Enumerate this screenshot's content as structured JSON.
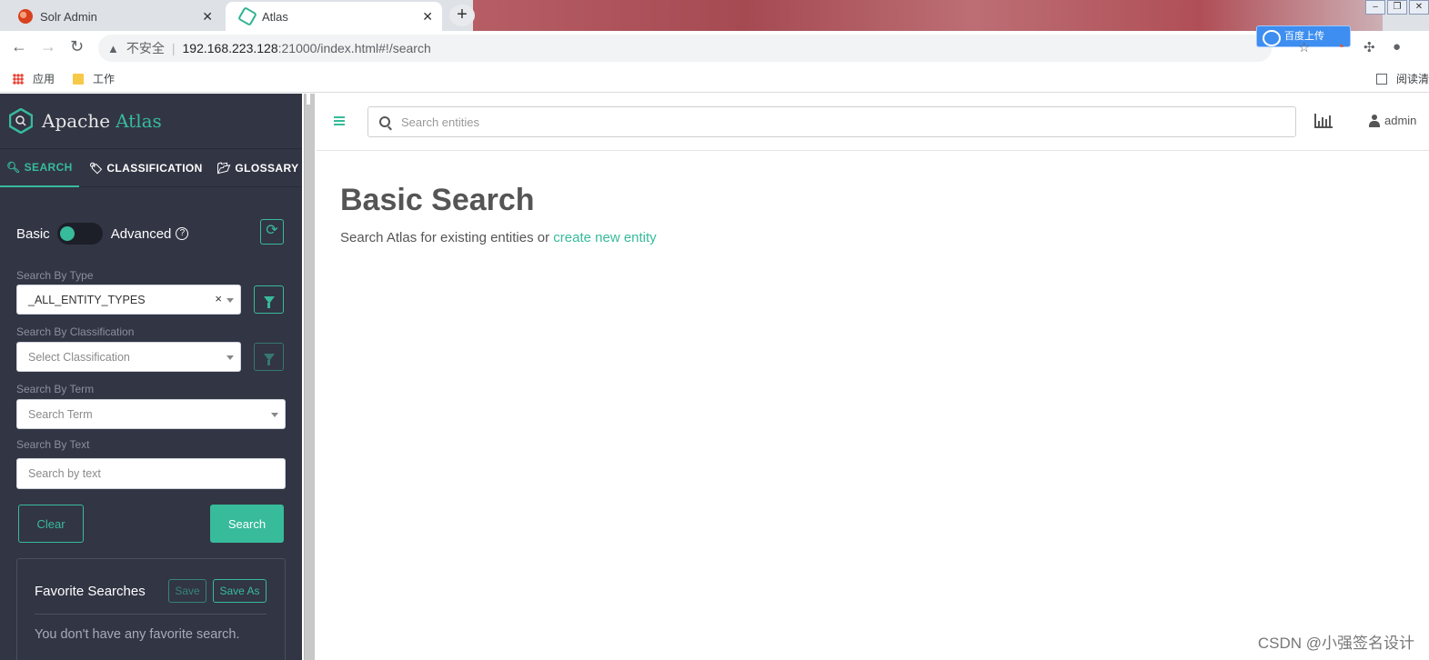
{
  "browser": {
    "tabs": [
      {
        "title": "Solr Admin",
        "close": "✕"
      },
      {
        "title": "Atlas",
        "close": "✕"
      }
    ],
    "new_tab": "+",
    "security_label": "不安全",
    "url_host": "192.168.223.128",
    "url_rest": ":21000/index.html#!/search",
    "bookmarks": [
      {
        "label": "应用"
      },
      {
        "label": "工作"
      }
    ],
    "reading_list": "阅读清"
  },
  "sidebar": {
    "logo_prefix": "Apache",
    "logo_name": "Atlas",
    "tabs": [
      {
        "label": "SEARCH",
        "icon": "search-icon"
      },
      {
        "label": "CLASSIFICATION",
        "icon": "tag-icon"
      },
      {
        "label": "GLOSSARY",
        "icon": "folder-open-icon"
      }
    ],
    "toggle": {
      "left": "Basic",
      "right": "Advanced",
      "state": "basic"
    },
    "type": {
      "label": "Search By Type",
      "value": "_ALL_ENTITY_TYPES",
      "clear": "×"
    },
    "classification": {
      "label": "Search By Classification",
      "placeholder": "Select Classification"
    },
    "term": {
      "label": "Search By Term",
      "placeholder": "Search Term"
    },
    "text": {
      "label": "Search By Text",
      "placeholder": "Search by text"
    },
    "clear_label": "Clear",
    "search_label": "Search",
    "favorites": {
      "title": "Favorite Searches",
      "save_label": "Save",
      "save_as_label": "Save As",
      "empty_text": "You don't have any favorite search."
    }
  },
  "main": {
    "search_placeholder": "Search entities",
    "user": "admin",
    "title": "Basic Search",
    "description": "Search Atlas for existing entities or ",
    "create_link": "create new entity"
  },
  "watermark": "CSDN @小强签名设计",
  "colors": {
    "accent": "#37bb9b",
    "sidebar_bg": "#323544"
  }
}
